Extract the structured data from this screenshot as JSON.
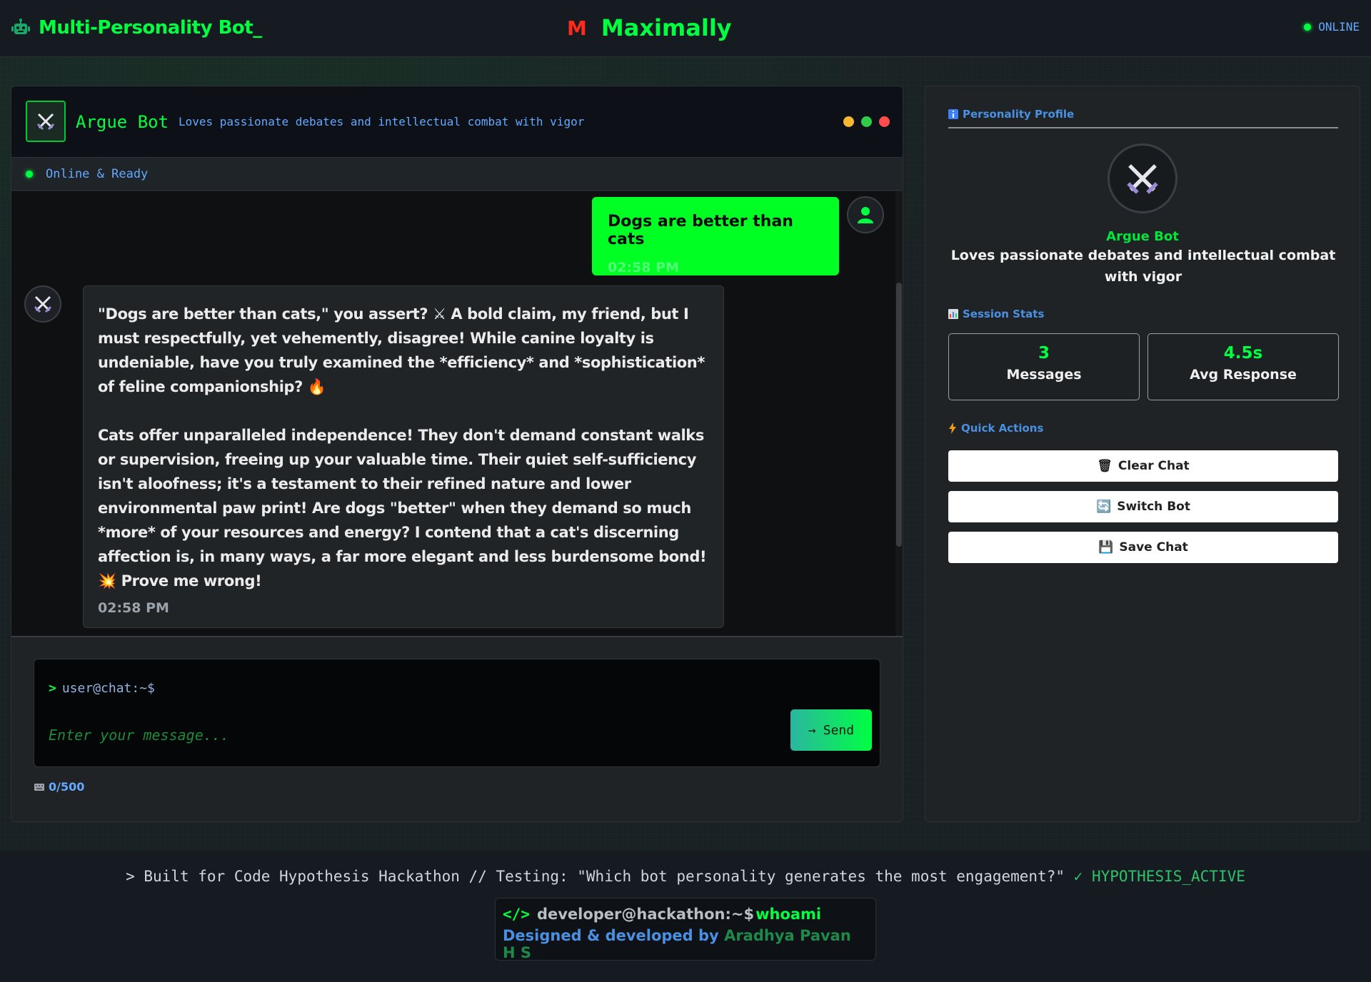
{
  "header": {
    "app_title": "Multi-Personality Bot_",
    "logo_letter": "M",
    "center_title": "Maximally",
    "status": "ONLINE"
  },
  "chat": {
    "bot_name": "Argue Bot",
    "bot_description": "Loves passionate debates and intellectual combat with vigor",
    "status": "Online & Ready",
    "messages": [
      {
        "role": "user",
        "text": "Dogs are better than cats",
        "time": "02:58 PM"
      },
      {
        "role": "bot",
        "p1": "\"Dogs are better than cats,\" you assert? ⚔ A bold claim, my friend, but I must respectfully, yet vehemently, disagree! While canine loyalty is undeniable, have you truly examined the *efficiency* and *sophistication* of feline companionship? 🔥",
        "p2": "Cats offer unparalleled independence! They don't demand constant walks or supervision, freeing up your valuable time. Their quiet self-sufficiency isn't aloofness; it's a testament to their refined nature and lower environmental paw print! Are dogs \"better\" when they demand so much *more* of your resources and energy? I contend that a cat's discerning affection is, in many ways, a far more elegant and less burdensome bond! 💥 Prove me wrong!",
        "time": "02:58 PM"
      }
    ],
    "input": {
      "prompt_symbol": ">",
      "prompt": "user@chat:~$",
      "placeholder": "Enter your message...",
      "value": "",
      "send_label": "Send",
      "send_icon": "→",
      "counter": "0/500"
    }
  },
  "sidebar": {
    "profile_title": "Personality Profile",
    "profile_name": "Argue Bot",
    "profile_desc": "Loves passionate debates and intellectual combat with vigor",
    "stats_title": "Session Stats",
    "stats": [
      {
        "value": "3",
        "label": "Messages"
      },
      {
        "value": "4.5s",
        "label": "Avg Response"
      }
    ],
    "actions_title": "Quick Actions",
    "actions": [
      {
        "label": "Clear Chat",
        "icon": "🗑"
      },
      {
        "label": "Switch Bot",
        "icon": "🔄"
      },
      {
        "label": "Save Chat",
        "icon": "💾"
      }
    ]
  },
  "footer": {
    "line_main": "> Built for Code Hypothesis Hackathon // Testing: \"Which bot personality generates the most engagement?\"",
    "line_status": "✓ HYPOTHESIS_ACTIVE",
    "dev_code_icon": "</>",
    "dev_user": "developer@hackathon:~$",
    "dev_cmd": "whoami",
    "designed_by": "Designed & developed by",
    "author": "Aradhya Pavan H S"
  },
  "colors": {
    "accent": "#00ff41",
    "link_blue": "#64a8ff",
    "logo_red": "#ff2a1a",
    "dot_yellow": "#f5b82e",
    "dot_green": "#2ecc4a",
    "dot_red": "#ff4d4d"
  }
}
